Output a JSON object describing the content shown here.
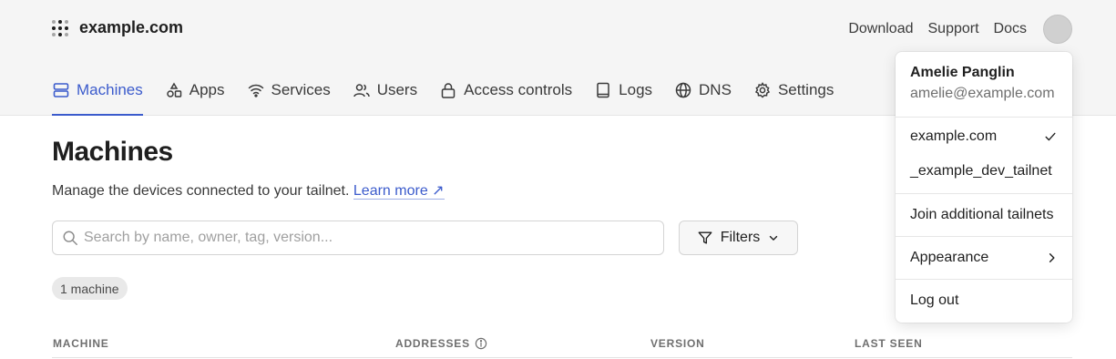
{
  "header": {
    "brand": "example.com",
    "links": [
      "Download",
      "Support",
      "Docs"
    ]
  },
  "nav": {
    "items": [
      {
        "label": "Machines",
        "icon": "server-icon",
        "active": true
      },
      {
        "label": "Apps",
        "icon": "apps-icon",
        "active": false
      },
      {
        "label": "Services",
        "icon": "wifi-icon",
        "active": false
      },
      {
        "label": "Users",
        "icon": "users-icon",
        "active": false
      },
      {
        "label": "Access controls",
        "icon": "lock-icon",
        "active": false
      },
      {
        "label": "Logs",
        "icon": "logs-icon",
        "active": false
      },
      {
        "label": "DNS",
        "icon": "globe-icon",
        "active": false
      },
      {
        "label": "Settings",
        "icon": "gear-icon",
        "active": false
      }
    ]
  },
  "main": {
    "title": "Machines",
    "subtitle": "Manage the devices connected to your tailnet.",
    "learn_more": "Learn more ↗",
    "search_placeholder": "Search by name, owner, tag, version...",
    "filters_label": "Filters",
    "count_badge": "1 machine",
    "columns": [
      "MACHINE",
      "ADDRESSES",
      "VERSION",
      "LAST SEEN"
    ]
  },
  "dropdown": {
    "user_name": "Amelie Panglin",
    "user_email": "amelie@example.com",
    "tailnets": [
      {
        "label": "example.com",
        "selected": true
      },
      {
        "label": "_example_dev_tailnet",
        "selected": false
      }
    ],
    "join_label": "Join additional tailnets",
    "appearance_label": "Appearance",
    "logout_label": "Log out"
  },
  "colors": {
    "accent": "#3b5bcc",
    "header_bg": "#f5f5f5"
  }
}
